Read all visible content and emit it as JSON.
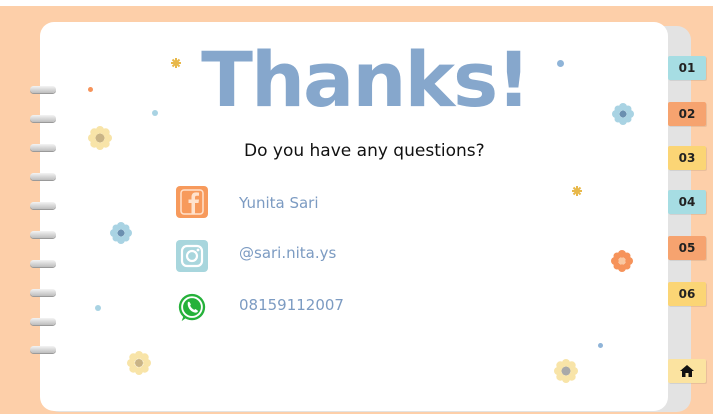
{
  "slide": {
    "title": "Thanks!",
    "question": "Do you have any questions?"
  },
  "contacts": [
    {
      "icon": "facebook-icon",
      "text": "Yunita Sari",
      "color": "#f79a5c"
    },
    {
      "icon": "instagram-icon",
      "text": "@sari.nita.ys",
      "color": "#a8d6dd"
    },
    {
      "icon": "whatsapp-icon",
      "text": "08159112007",
      "color": "#25b13a"
    }
  ],
  "tabs": [
    {
      "label": "01",
      "color": "#a6dde3"
    },
    {
      "label": "02",
      "color": "#f6a36f"
    },
    {
      "label": "03",
      "color": "#fbd575"
    },
    {
      "label": "04",
      "color": "#a6dde3"
    },
    {
      "label": "05",
      "color": "#f6a36f"
    },
    {
      "label": "06",
      "color": "#fbd575"
    }
  ],
  "home_tab": {
    "icon": "home-icon",
    "color": "#fbe3a0"
  },
  "colors": {
    "background": "#fdcfa9",
    "title": "#86a7cc",
    "contact_text": "#7c9bc2"
  }
}
